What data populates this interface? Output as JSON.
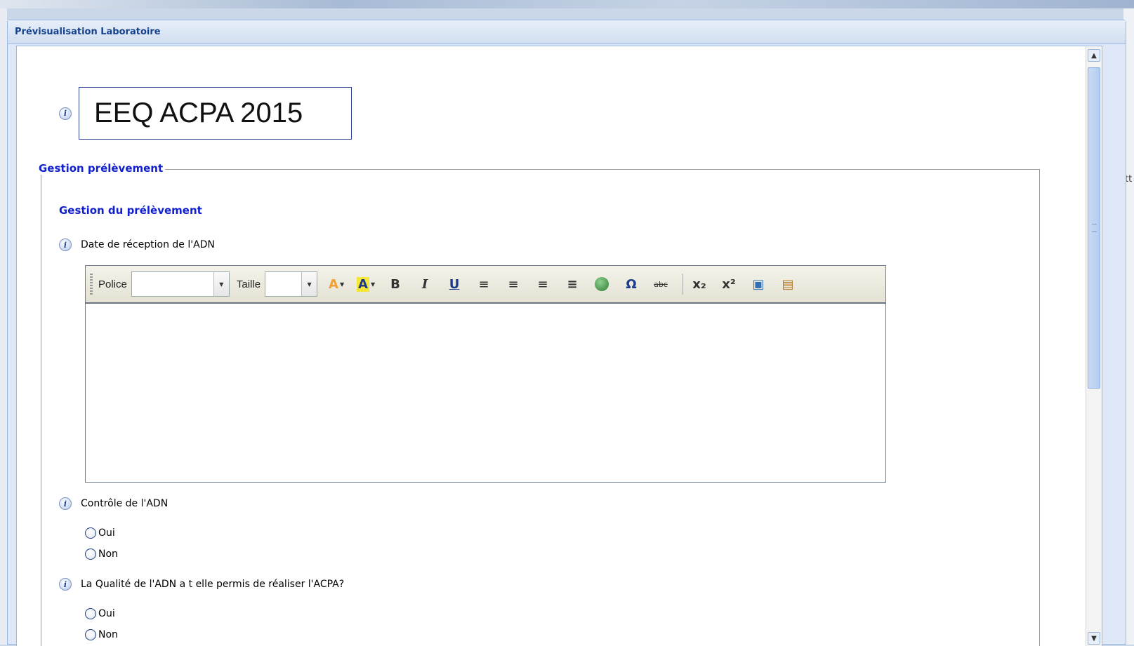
{
  "window": {
    "title": "Prévisualisation Laboratoire"
  },
  "background": {
    "right_fragment": "tt"
  },
  "form": {
    "title": "EEQ ACPA 2015",
    "fieldset_legend": "Gestion prélèvement",
    "section_title": "Gestion du prélèvement",
    "questions": [
      {
        "label": "Date de réception de l'ADN"
      },
      {
        "label": "Contrôle de l'ADN",
        "options": [
          "Oui",
          "Non"
        ]
      },
      {
        "label": "La Qualité de l'ADN a t elle permis de réaliser l'ACPA?",
        "options": [
          "Oui",
          "Non"
        ]
      }
    ]
  },
  "editor": {
    "font_label": "Police",
    "size_label": "Taille",
    "font_value": "",
    "size_value": "",
    "buttons": [
      {
        "icon": "font-color-icon",
        "glyph": "A"
      },
      {
        "icon": "highlight-color-icon",
        "glyph": "A"
      },
      {
        "icon": "bold-icon",
        "glyph": "B"
      },
      {
        "icon": "italic-icon",
        "glyph": "I"
      },
      {
        "icon": "underline-icon",
        "glyph": "U"
      },
      {
        "icon": "align-left-icon",
        "glyph": "≡"
      },
      {
        "icon": "align-center-icon",
        "glyph": "≡"
      },
      {
        "icon": "align-right-icon",
        "glyph": "≡"
      },
      {
        "icon": "justify-icon",
        "glyph": "≡"
      },
      {
        "icon": "insert-link-icon",
        "glyph": "🌐"
      },
      {
        "icon": "special-char-icon",
        "glyph": "Ω"
      },
      {
        "icon": "strikethrough-icon",
        "glyph": "abc"
      },
      {
        "icon": "subscript-icon",
        "glyph": "x₂"
      },
      {
        "icon": "superscript-icon",
        "glyph": "x²"
      },
      {
        "icon": "source-icon",
        "glyph": "▣"
      },
      {
        "icon": "paste-word-icon",
        "glyph": "▤"
      }
    ]
  },
  "colors": {
    "window_title": "#15428b",
    "section_blue": "#1122cc",
    "font_color_icon": "#f0a030",
    "highlight_icon": "#f5e63a"
  }
}
